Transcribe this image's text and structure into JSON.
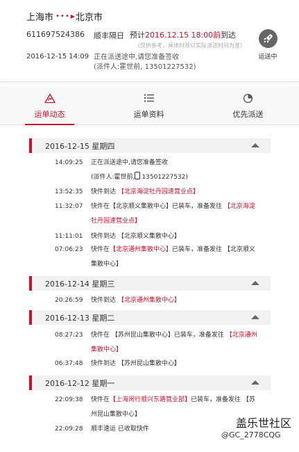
{
  "header": {
    "origin": "上海市",
    "destination": "北京市",
    "waybill_no": "611697524386",
    "service": "顺丰隔日",
    "eta_prefix": "预计",
    "eta_time": "2016.12.15 18:00前",
    "eta_suffix": "到达",
    "eta_note": "（仅供参考，具体时效以实际派送时间为准）",
    "last_update_time": "2016-12-15 14:09",
    "last_update_msg": "正在派送途中,请您准备签收",
    "last_update_courier": "(派件人:霍世前,    13501227532)",
    "status_label": "运送中"
  },
  "tabs": [
    {
      "label": "运单动态",
      "active": true
    },
    {
      "label": "运单资料",
      "active": false
    },
    {
      "label": "优先派送",
      "active": false
    }
  ],
  "timeline": [
    {
      "date": "2016-12-15 星期四",
      "events": [
        {
          "time": "14:09:25",
          "line1": "正在派送途中,请您准备签收",
          "line2a": "(派件人:霍世前,",
          "line2b": "13501227532)"
        },
        {
          "time": "13:52:35",
          "p1": "快件到达 ",
          "r1": "【北京海淀牡丹园速营业点】"
        },
        {
          "time": "11:32:07",
          "p1": "快件在【北京顺义集散中心】已装车，准备发往 ",
          "r1": "【北京海淀",
          "r2": "牡丹园速营业点】"
        },
        {
          "time": "11:11:01",
          "p1": "快件到达 【北京顺义集散中心】"
        },
        {
          "time": "07:06:23",
          "p1": "快件在",
          "r1": "【北京通州集散中心】",
          "p2": "已装车，准备发往 【北京顺义",
          "p3": "集散中心】"
        }
      ]
    },
    {
      "date": "2016-12-14 星期三",
      "events": [
        {
          "time": "20:26:59",
          "p1": "快件到达 ",
          "r1": "【北京通州集散中心】"
        }
      ]
    },
    {
      "date": "2016-12-13 星期二",
      "events": [
        {
          "time": "08:27:23",
          "p1": "快件在 【苏州昆山集散中心】已装车，准备发往 ",
          "r1": "【北京通州",
          "r2": "集散中心】"
        },
        {
          "time": "06:37:48",
          "p1": "快件到达 【苏州昆山集散中心】"
        }
      ]
    },
    {
      "date": "2016-12-12 星期一",
      "events": [
        {
          "time": "22:09:38",
          "p1": "快件在",
          "r1": "【上海闵行顺兴东路营业部】",
          "p2": "已装车，准备发往 【苏",
          "p3": "州昆山集散中心】"
        },
        {
          "time": "22:09:28",
          "p1": "顺丰速运 已收取快件"
        }
      ]
    }
  ],
  "watermark": {
    "line1": "盖乐世社区",
    "line2": "@GC_2778CQG"
  },
  "colors": {
    "accent": "#d0112b",
    "badge_bg": "#666666"
  },
  "icons": {
    "tab1": "warning-triangle-icon",
    "tab2": "list-icon",
    "tab3": "pie-icon",
    "status": "rocket-icon"
  }
}
